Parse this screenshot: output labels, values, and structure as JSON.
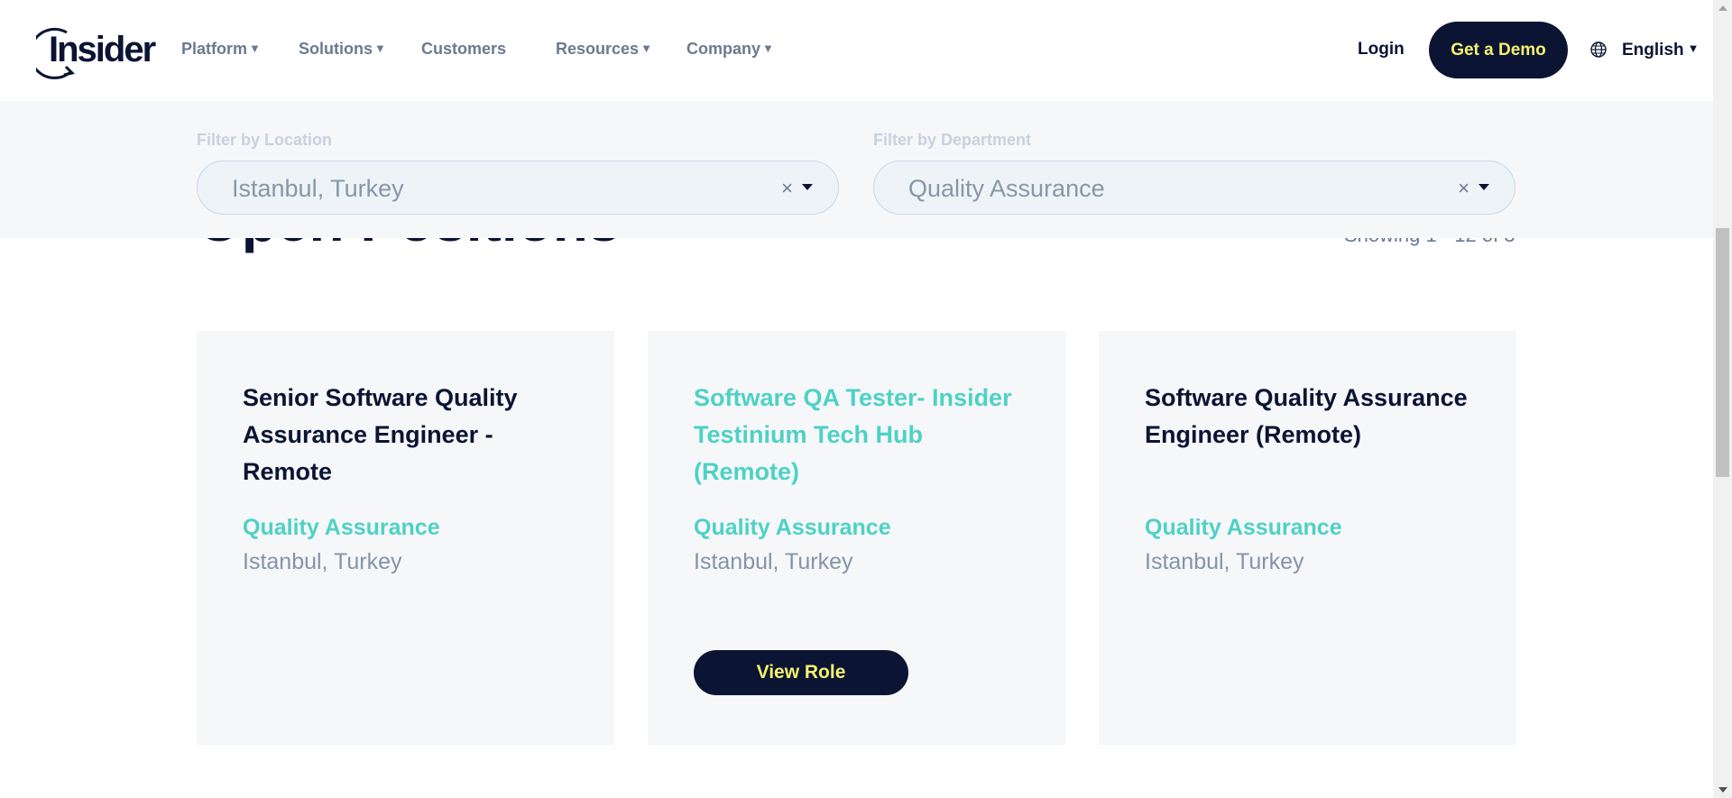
{
  "brand": {
    "logo_text": "Insider"
  },
  "nav": {
    "items": [
      {
        "label": "Platform",
        "dropdown": true
      },
      {
        "label": "Solutions",
        "dropdown": true
      },
      {
        "label": "Customers",
        "dropdown": false
      },
      {
        "label": "Resources",
        "dropdown": true
      },
      {
        "label": "Company",
        "dropdown": true
      }
    ],
    "login_label": "Login",
    "demo_label": "Get a Demo",
    "language": "English",
    "caret": "▼"
  },
  "filters": {
    "location": {
      "label": "Filter by Location",
      "value": "Istanbul, Turkey",
      "clear": "×"
    },
    "department": {
      "label": "Filter by Department",
      "value": "Quality Assurance",
      "clear": "×"
    }
  },
  "positions": {
    "heading": "Open Positions",
    "showing": "Showing 1 - 12 of 3"
  },
  "jobs": [
    {
      "title": "Senior Software Quality Assurance Engineer - Remote",
      "department": "Quality Assurance",
      "location": "Istanbul, Turkey"
    },
    {
      "title": "Software QA Tester- Insider Testinium Tech Hub (Remote)",
      "department": "Quality Assurance",
      "location": "Istanbul, Turkey",
      "button": "View Role"
    },
    {
      "title": "Software Quality Assurance Engineer (Remote)",
      "department": "Quality Assurance",
      "location": "Istanbul, Turkey"
    }
  ],
  "colors": {
    "navy": "#0b1433",
    "accent_teal": "#4fd1c5",
    "accent_yellow": "#f5f070",
    "muted": "#6b7a90"
  },
  "icons": [
    "globe-icon",
    "chevron-down-icon",
    "clear-icon"
  ]
}
